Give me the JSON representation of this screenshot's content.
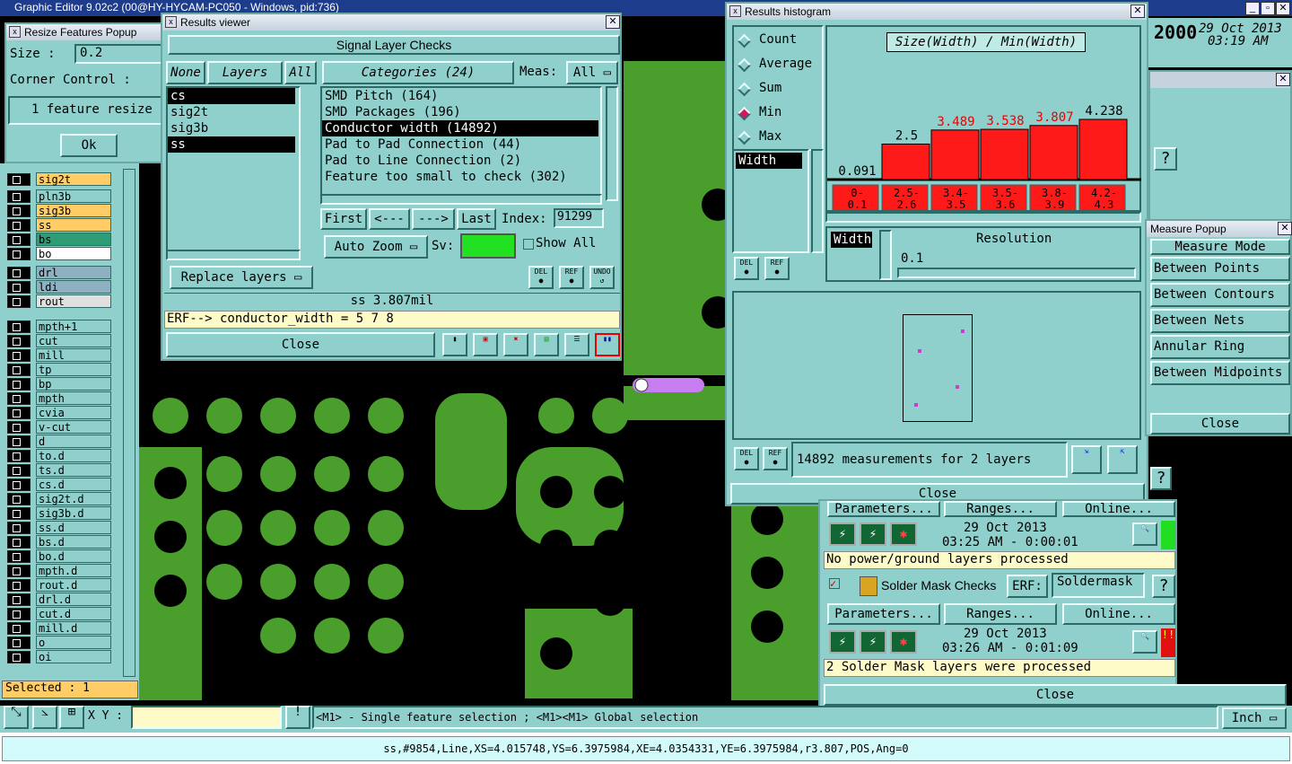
{
  "app_title": "Graphic Editor 9.02c2 (00@HY-HYCAM-PC050 - Windows, pid:736)",
  "clock": {
    "year_frag": "2000",
    "date": "29 Oct 2013",
    "time": "03:19 AM"
  },
  "resize_popup": {
    "title": "Resize Features Popup",
    "size_label": "Size :",
    "size_value": "0.2",
    "corner_label": "Corner Control :",
    "msg": "1 feature resize",
    "ok": "Ok"
  },
  "layers": {
    "top": [
      {
        "name": "sig2t",
        "bg": "#ffcc66"
      },
      {
        "name": "pln3b",
        "bg": "#8fd0cc"
      },
      {
        "name": "sig3b",
        "bg": "#ffcc66"
      },
      {
        "name": "ss",
        "bg": "#ffcc66"
      },
      {
        "name": "bs",
        "bg": "#2e9c74"
      },
      {
        "name": "bo",
        "bg": "#ffffff"
      },
      {
        "name": "drl",
        "bg": "#8fb0c0"
      },
      {
        "name": "ldi",
        "bg": "#8fb0c0"
      },
      {
        "name": "rout",
        "bg": "#e0e0e0"
      }
    ],
    "rest": [
      "mpth+1",
      "cut",
      "mill",
      "tp",
      "bp",
      "mpth",
      "cvia",
      "v-cut",
      "d",
      "to.d",
      "ts.d",
      "cs.d",
      "sig2t.d",
      "sig3b.d",
      "ss.d",
      "bs.d",
      "bo.d",
      "mpth.d",
      "rout.d",
      "drl.d",
      "cut.d",
      "mill.d",
      "o",
      "oi"
    ],
    "selected": "Selected : 1"
  },
  "results_viewer": {
    "title": "Results viewer",
    "header": "Signal Layer Checks",
    "none": "None",
    "layers_btn": "Layers",
    "all_btn": "All",
    "layer_list": [
      "cs",
      "sig2t",
      "sig3b",
      "ss"
    ],
    "categories_btn": "Categories (24)",
    "meas_label": "Meas:",
    "meas_value": "All",
    "categories": [
      "SMD Pitch (164)",
      "SMD Packages (196)",
      "Conductor width (14892)",
      "Pad to Pad Connection (44)",
      "Pad to Line Connection (2)",
      "Feature too small to check (302)"
    ],
    "first": "First",
    "prev": "<---",
    "next": "--->",
    "last": "Last",
    "index_label": "Index:",
    "index_value": "91299",
    "auto_zoom": "Auto Zoom",
    "sv_label": "Sv:",
    "show_all": "Show All",
    "replace": "Replace layers",
    "del": "DEL",
    "ref": "REF",
    "undo": "UNDO",
    "status": "ss 3.807mil",
    "erf": "ERF--> conductor_width = 5 7 8",
    "close": "Close"
  },
  "histogram": {
    "title": "Results histogram",
    "modes": [
      "Count",
      "Average",
      "Sum",
      "Min",
      "Max"
    ],
    "selected_mode": "Min",
    "formula": "Size(Width) / Min(Width)",
    "attr": "Width",
    "width_label": "Width",
    "resolution_label": "Resolution",
    "resolution_value": "0.1",
    "footer": "14892 measurements for 2 layers",
    "close": "Close",
    "del": "DEL",
    "ref": "REF"
  },
  "chart_data": {
    "type": "bar",
    "categories": [
      "0-0.1",
      "2.5-2.6",
      "3.4-3.5",
      "3.5-3.6",
      "3.8-3.9",
      "4.2-4.3"
    ],
    "values": [
      0.091,
      2.5,
      3.489,
      3.538,
      3.807,
      4.238
    ],
    "value_labels": [
      "0.091",
      "2.5",
      "3.489",
      "3.538",
      "3.807",
      "4.238"
    ],
    "label_colors": [
      "#000",
      "#000",
      "#e00",
      "#e00",
      "#e00",
      "#000"
    ],
    "title": "Size(Width) / Min(Width)"
  },
  "measure_popup": {
    "title": "Measure Popup",
    "mode_label": "Measure Mode",
    "items": [
      "Between Points",
      "Between Contours",
      "Between Nets",
      "Annular Ring",
      "Between Midpoints"
    ],
    "close": "Close"
  },
  "checklist": {
    "parameters": "Parameters...",
    "ranges": "Ranges...",
    "online": "Online...",
    "run1_date": "29 Oct 2013",
    "run1_time": "03:25 AM - 0:00:01",
    "run1_msg": "No power/ground layers processed",
    "solder_title": "Solder Mask Checks",
    "erf_label": "ERF:",
    "erf_value": "Soldermask",
    "run2_date": "29 Oct 2013",
    "run2_time": "03:26 AM - 0:01:09",
    "run2_msg": "2 Solder Mask layers were processed",
    "close": "Close",
    "help": "?"
  },
  "bottom": {
    "xy_label": "X Y :",
    "hint": "<M1> - Single feature selection ; <M1><M1> Global selection",
    "units": "Inch",
    "status": "ss,#9854,Line,XS=4.015748,YS=6.3975984,XE=4.0354331,YE=6.3975984,r3.807,POS,Ang=0"
  }
}
